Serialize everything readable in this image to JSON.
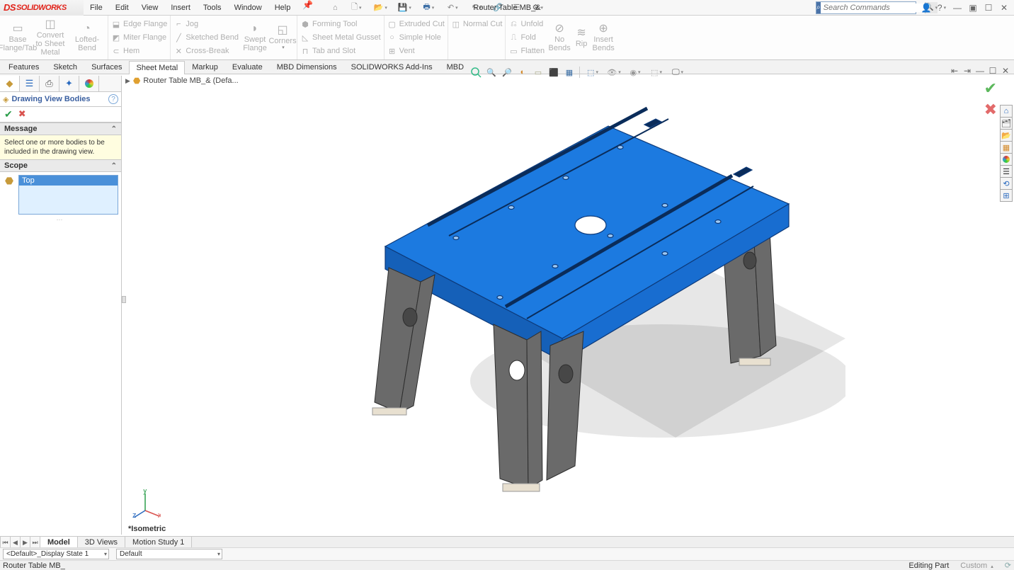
{
  "app": {
    "brand": "SOLIDWORKS",
    "doc_title": "Router Table MB_&"
  },
  "menu": [
    "File",
    "Edit",
    "View",
    "Insert",
    "Tools",
    "Window",
    "Help"
  ],
  "search": {
    "placeholder": "Search Commands"
  },
  "ribbon": {
    "big": [
      {
        "label1": "Base",
        "label2": "Flange/Tab"
      },
      {
        "label1": "Convert",
        "label2": "to Sheet",
        "label3": "Metal"
      },
      {
        "label1": "Lofted-Bend",
        "label2": ""
      },
      {
        "label1": "Swept",
        "label2": "Flange"
      },
      {
        "label1": "Corners",
        "label2": ""
      },
      {
        "label1": "No",
        "label2": "Bends"
      },
      {
        "label1": "Rip",
        "label2": ""
      },
      {
        "label1": "Insert",
        "label2": "Bends"
      }
    ],
    "col1": [
      "Edge Flange",
      "Miter Flange",
      "Hem"
    ],
    "col1b": [
      "Jog",
      "Sketched Bend",
      "Cross-Break"
    ],
    "col2": [
      "Forming Tool",
      "Sheet Metal Gusset",
      "Tab and Slot"
    ],
    "col3": [
      "Extruded Cut",
      "Simple Hole",
      "Vent"
    ],
    "col3b": [
      "Normal Cut"
    ],
    "col4": [
      "Unfold",
      "Fold",
      "Flatten"
    ]
  },
  "ribbon_tabs": [
    "Features",
    "Sketch",
    "Surfaces",
    "Sheet Metal",
    "Markup",
    "Evaluate",
    "MBD Dimensions",
    "SOLIDWORKS Add-Ins",
    "MBD"
  ],
  "ribbon_active": 3,
  "breadcrumb": "Router Table MB_&  (Defa...",
  "pm": {
    "title": "Drawing View Bodies",
    "message_h": "Message",
    "message": "Select one or more bodies to be included in the drawing view.",
    "scope_h": "Scope",
    "scope_item": "Top"
  },
  "bottom_tabs": [
    "Model",
    "3D Views",
    "Motion Study 1"
  ],
  "bottom_active": 0,
  "config": {
    "display_state": "<Default>_Display State 1",
    "second": "Default"
  },
  "status": {
    "left": "Router Table MB_",
    "mode": "Editing Part",
    "sys": "Custom"
  },
  "view_label": "*Isometric"
}
